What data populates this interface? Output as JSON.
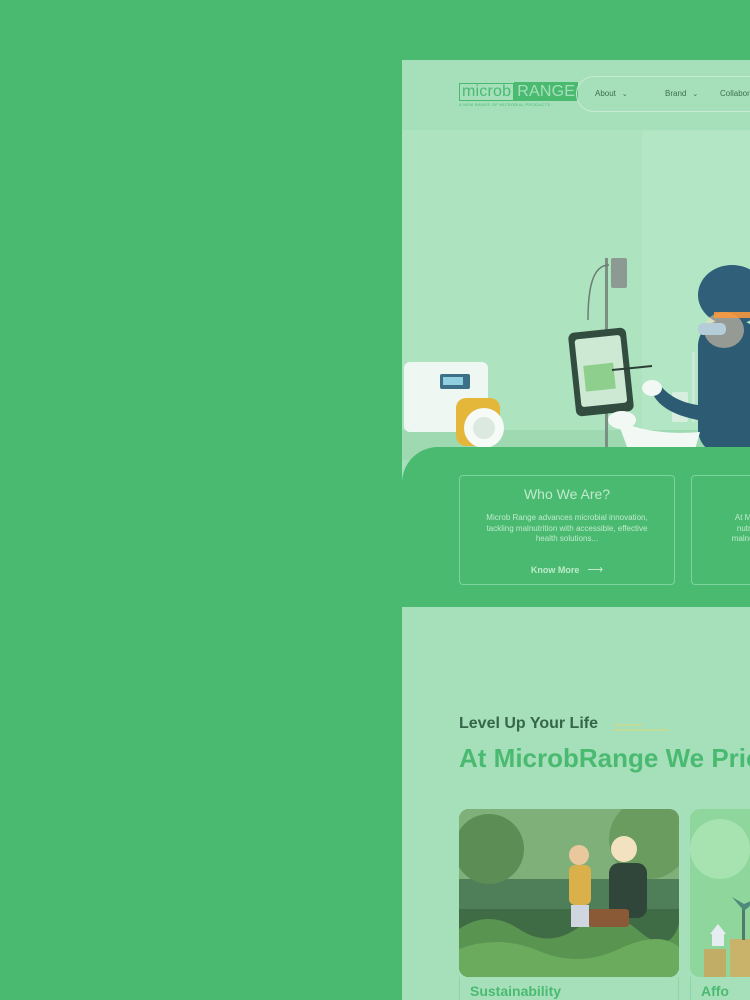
{
  "colors": {
    "background": "#4aba70",
    "page": "#a6e0bb",
    "accent": "#4aba70"
  },
  "header": {
    "logo_part1": "microb",
    "logo_part2": "RANGE",
    "logo_tagline": "A NEW RANGE OF MICROBIAL PRODUCTS",
    "nav": [
      {
        "label": "About",
        "icon": "chevron-down-icon"
      },
      {
        "label": "Brand",
        "icon": "chevron-down-icon"
      },
      {
        "label": "Collaborat"
      }
    ]
  },
  "info": {
    "card1": {
      "title": "Who We Are?",
      "text": "Microb Range advances microbial innovation, tackling malnutrition with accessible, effective health solutions...",
      "link": "Know More",
      "link_icon": "arrow-right-icon"
    },
    "card2": {
      "text_lines": [
        "At Mic",
        "nutra",
        "malnutri"
      ]
    }
  },
  "priorities": {
    "kicker": "Level Up Your Life",
    "headline": "At MicrobRange We Prio",
    "cards": [
      {
        "title": "Sustainability"
      },
      {
        "title": "Affo"
      }
    ]
  }
}
